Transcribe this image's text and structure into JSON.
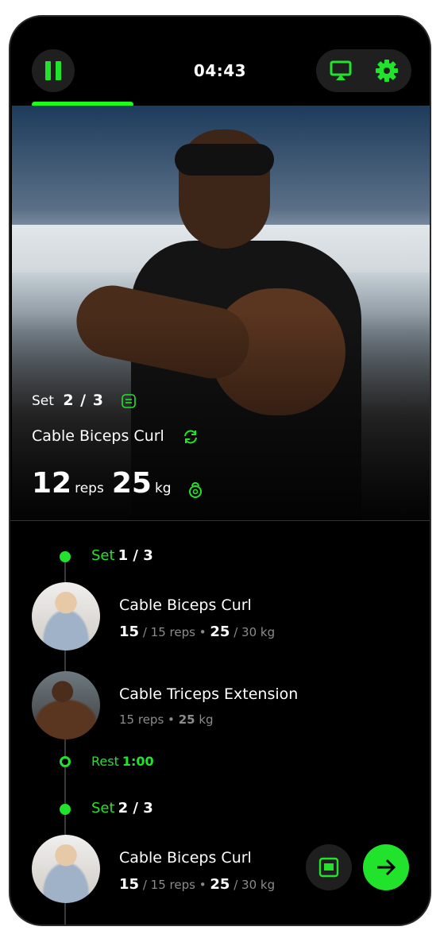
{
  "header": {
    "timer": "04:43",
    "pause_icon": "pause-icon",
    "cast_icon": "cast-icon",
    "settings_icon": "gear-icon",
    "progress": 0.25,
    "accent": "#22e32b"
  },
  "current": {
    "set_label": "Set",
    "set_value": "2 / 3",
    "exercise": "Cable Biceps Curl",
    "reps_value": "12",
    "reps_unit": "reps",
    "weight_value": "25",
    "weight_unit": "kg"
  },
  "timeline": {
    "set1": {
      "label": "Set",
      "value": "1 / 3"
    },
    "item1": {
      "name": "Cable Biceps Curl",
      "reps_done": "15",
      "reps_total": "/ 15 reps",
      "sep": "•",
      "weight_done": "25",
      "weight_total": "/ 30 kg"
    },
    "item2": {
      "name": "Cable Triceps Extension",
      "reps_prefix": "15 reps",
      "sep": "•",
      "weight": "25",
      "weight_unit": "kg"
    },
    "rest": {
      "label": "Rest",
      "value": "1:00"
    },
    "set2": {
      "label": "Set",
      "value": "2 / 3"
    },
    "item3": {
      "name": "Cable Biceps Curl",
      "reps_done": "15",
      "reps_total": "/ 15 reps",
      "sep": "•",
      "weight_done": "25",
      "weight_total": "/ 30 kg"
    }
  }
}
